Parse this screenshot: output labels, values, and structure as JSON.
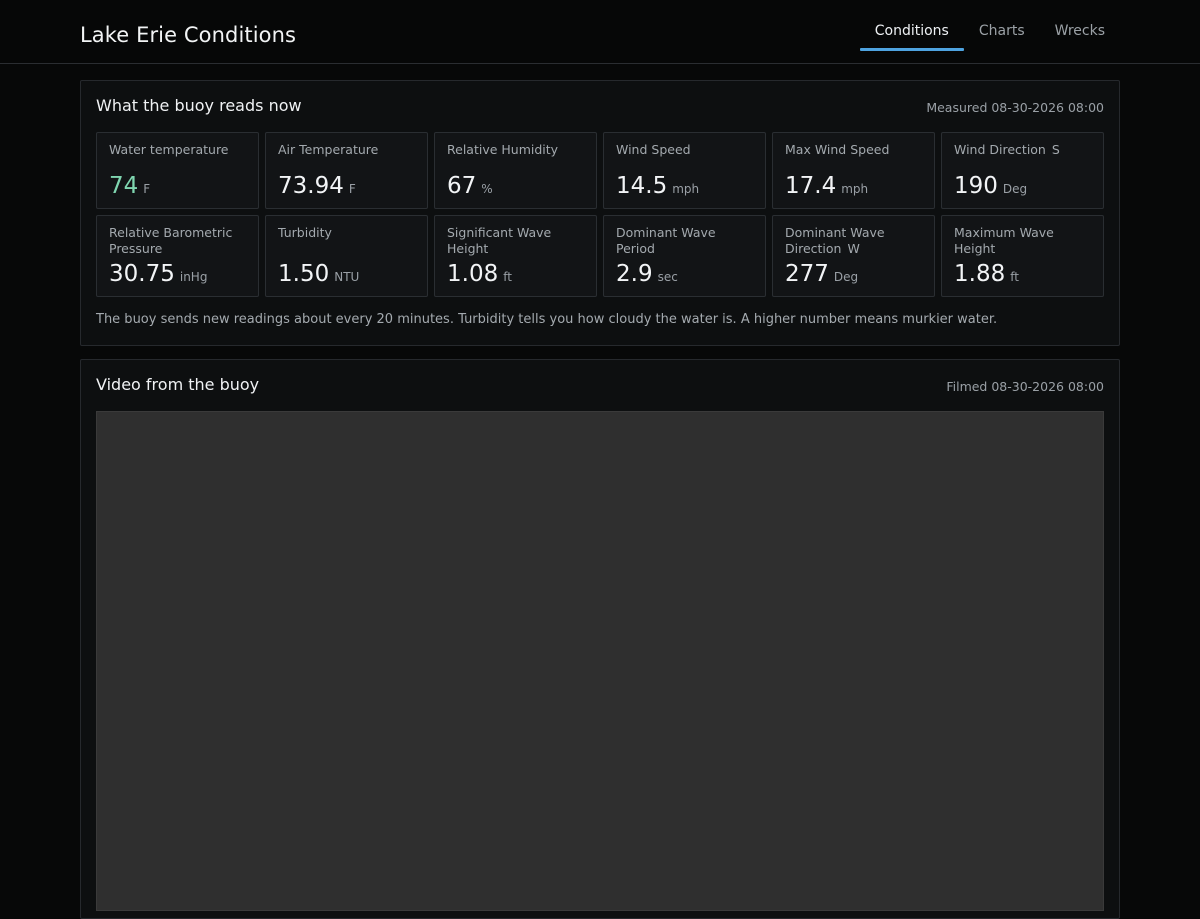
{
  "app": {
    "title": "Lake Erie Conditions"
  },
  "nav": {
    "tabs": [
      {
        "label": "Conditions",
        "active": true
      },
      {
        "label": "Charts",
        "active": false
      },
      {
        "label": "Wrecks",
        "active": false
      }
    ]
  },
  "now": {
    "title": "What the buoy reads now",
    "measured": "Measured 08-30-2026 08:00",
    "cards": [
      {
        "label": "Water temperature",
        "value": "74",
        "unit": "F",
        "dir": ""
      },
      {
        "label": "Air Temperature",
        "value": "73.94",
        "unit": "F",
        "dir": ""
      },
      {
        "label": "Relative Humidity",
        "value": "67",
        "unit": "%",
        "dir": ""
      },
      {
        "label": "Wind Speed",
        "value": "14.5",
        "unit": "mph",
        "dir": ""
      },
      {
        "label": "Max Wind Speed",
        "value": "17.4",
        "unit": "mph",
        "dir": ""
      },
      {
        "label": "Wind Direction",
        "value": "190",
        "unit": "Deg",
        "dir": "S"
      },
      {
        "label": "Relative Barometric Pressure",
        "value": "30.75",
        "unit": "inHg",
        "dir": ""
      },
      {
        "label": "Turbidity",
        "value": "1.50",
        "unit": "NTU",
        "dir": ""
      },
      {
        "label": "Significant Wave Height",
        "value": "1.08",
        "unit": "ft",
        "dir": ""
      },
      {
        "label": "Dominant Wave Period",
        "value": "2.9",
        "unit": "sec",
        "dir": ""
      },
      {
        "label": "Dominant Wave Direction",
        "value": "277",
        "unit": "Deg",
        "dir": "W"
      },
      {
        "label": "Maximum Wave Height",
        "value": "1.88",
        "unit": "ft",
        "dir": ""
      }
    ],
    "note": "The buoy sends new readings about every 20 minutes. Turbidity tells you how cloudy the water is. A higher number means murkier water."
  },
  "video": {
    "title": "Video from the buoy",
    "filmed": "Filmed 08-30-2026 08:00"
  },
  "colors": {
    "accent": "#4ea3e0",
    "water_temp": "#7fd6b0",
    "background": "#070808",
    "panel": "#0d0f10",
    "video_placeholder": "#2f2f2f"
  }
}
